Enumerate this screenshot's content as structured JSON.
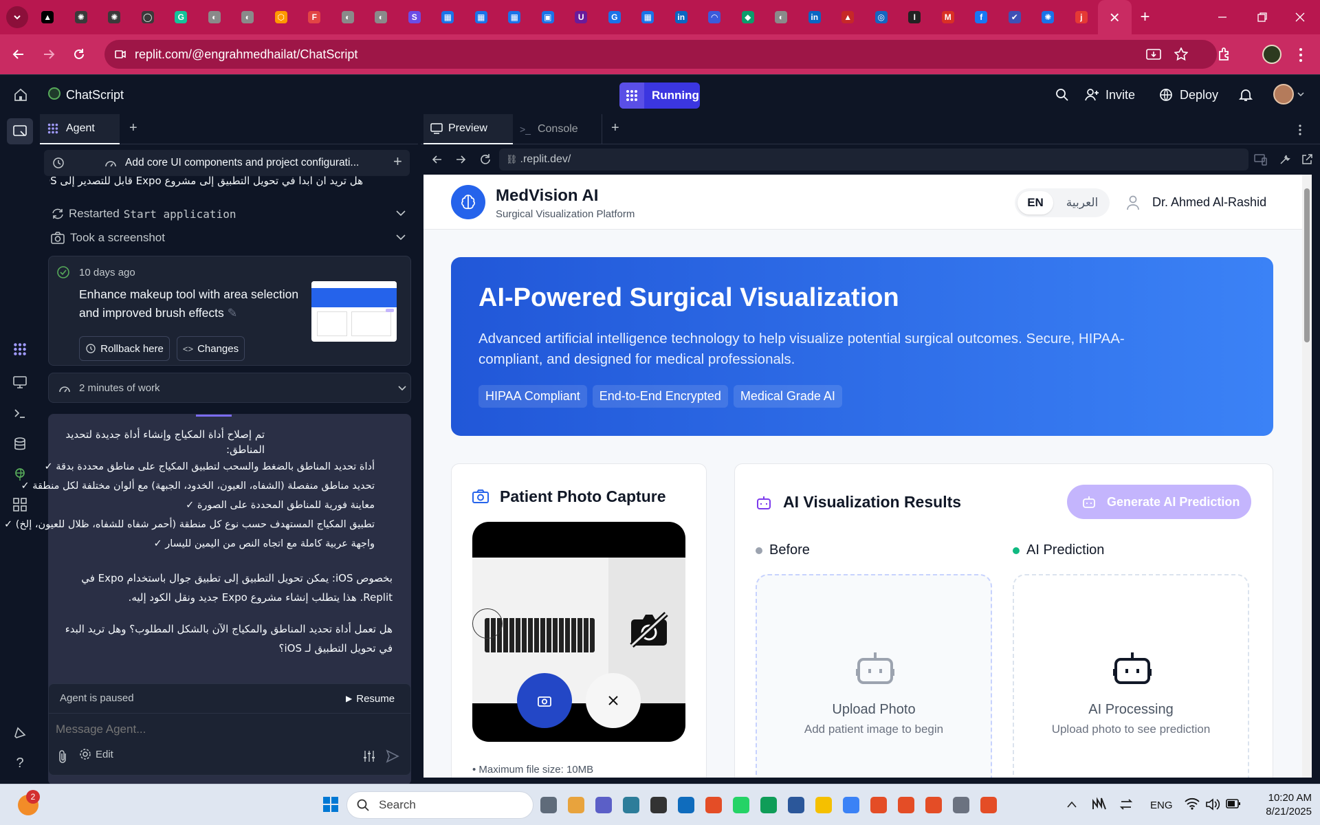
{
  "browser": {
    "tabs": [
      {
        "icon": "chevron-down-icon"
      },
      {
        "icon": "openai-icon",
        "color": "#000000",
        "glyph": "▲"
      },
      {
        "icon": "openai-icon",
        "color": "#3a3a3a",
        "glyph": "✺"
      },
      {
        "icon": "openai-icon",
        "color": "#3a3a3a",
        "glyph": "✺"
      },
      {
        "icon": "github-icon",
        "color": "#3a3a3a",
        "glyph": "◯"
      },
      {
        "icon": "grammarly-icon",
        "color": "#15c39a",
        "glyph": "G"
      },
      {
        "icon": "globe-icon",
        "color": "#8a8a8a",
        "glyph": "◐"
      },
      {
        "icon": "globe-icon",
        "color": "#8a8a8a",
        "glyph": "◐"
      },
      {
        "icon": "hexagon-icon",
        "color": "#ff9800",
        "glyph": "⬡"
      },
      {
        "icon": "figma-icon",
        "color": "#e24545",
        "glyph": "F"
      },
      {
        "icon": "globe-icon",
        "color": "#8a8a8a",
        "glyph": "◐"
      },
      {
        "icon": "globe-icon",
        "color": "#8a8a8a",
        "glyph": "◐"
      },
      {
        "icon": "stripe-icon",
        "color": "#6b4de6",
        "glyph": "S"
      },
      {
        "icon": "grid-icon",
        "color": "#1a73e8",
        "glyph": "▦"
      },
      {
        "icon": "grid-icon",
        "color": "#1a73e8",
        "glyph": "▦"
      },
      {
        "icon": "grid-icon",
        "color": "#1a73e8",
        "glyph": "▦"
      },
      {
        "icon": "teams-icon",
        "color": "#1a73e8",
        "glyph": "▣"
      },
      {
        "icon": "u-icon",
        "color": "#6a1b9a",
        "glyph": "U"
      },
      {
        "icon": "g-icon",
        "color": "#1a73e8",
        "glyph": "G"
      },
      {
        "icon": "grid-icon",
        "color": "#1a73e8",
        "glyph": "▦"
      },
      {
        "icon": "linkedin-icon",
        "color": "#0a66c2",
        "glyph": "in"
      },
      {
        "icon": "edge-icon",
        "color": "#3b5bdb",
        "glyph": "◠"
      },
      {
        "icon": "diamond-icon",
        "color": "#0c9d6c",
        "glyph": "◆"
      },
      {
        "icon": "globe-icon",
        "color": "#8a8a8a",
        "glyph": "◐"
      },
      {
        "icon": "linkedin-icon",
        "color": "#0a66c2",
        "glyph": "in"
      },
      {
        "icon": "app-icon",
        "color": "#c62828",
        "glyph": "▲"
      },
      {
        "icon": "compass-icon",
        "color": "#1565c0",
        "glyph": "◎"
      },
      {
        "icon": "i-icon",
        "color": "#222222",
        "glyph": "I"
      },
      {
        "icon": "gmail-icon",
        "color": "#d93025",
        "glyph": "M"
      },
      {
        "icon": "facebook-icon",
        "color": "#1877f2",
        "glyph": "f"
      },
      {
        "icon": "check-icon",
        "color": "#3f51b5",
        "glyph": "✔"
      },
      {
        "icon": "openai-icon",
        "color": "#1a73e8",
        "glyph": "✺"
      },
      {
        "icon": "j-icon",
        "color": "#e53935",
        "glyph": "j"
      }
    ],
    "active_tab_close": "×",
    "new_tab": "+",
    "url": "replit.com/@engrahmedhailat/ChatScript"
  },
  "replit": {
    "project_name": "ChatScript",
    "running_label": "Running",
    "invite_label": "Invite",
    "deploy_label": "Deploy"
  },
  "agent": {
    "tab_label": "Agent",
    "task_title": "Add core UI components and project configurati...",
    "prev_message_tail": "هل تريد ان ابدا في تحويل التطبيق إلى مشروع Expo قابل للتصدير إلى iOS؟",
    "restarted_label": "Restarted",
    "restarted_code": "Start application",
    "screenshot_label": "Took a screenshot",
    "checkpoint_time": "10 days ago",
    "checkpoint_title": "Enhance makeup tool with area selection and improved brush effects",
    "rollback_label": "Rollback here",
    "changes_label": "Changes",
    "work_label": "2 minutes of work",
    "message": {
      "intro": "تم إصلاح أداة المكياج وإنشاء أداة جديدة لتحديد المناطق:",
      "bullets": [
        "أداة تحديد المناطق بالضغط والسحب لتطبيق المكياج على مناطق محددة بدقة ✓",
        "تحديد مناطق منفصلة (الشفاه، العيون، الخدود، الجبهة) مع ألوان مختلفة لكل منطقة ✓",
        "معاينة فورية للمناطق المحددة على الصورة ✓",
        "تطبيق المكياج المستهدف حسب نوع كل منطقة (أحمر شفاه للشفاه، ظلال للعيون، إلخ) ✓",
        "واجهة عربية كاملة مع اتجاه النص من اليمين لليسار ✓"
      ],
      "ios_note": "بخصوص iOS: يمكن تحويل التطبيق إلى تطبيق جوال باستخدام Expo في Replit. هذا يتطلب إنشاء مشروع Expo جديد ونقل الكود إليه.",
      "question": "هل تعمل أداة تحديد المناطق والمكياج الآن بالشكل المطلوب؟ وهل تريد البدء في تحويل التطبيق لـ iOS؟"
    },
    "paused_label": "Agent is paused",
    "resume_label": "Resume",
    "input_placeholder": "Message Agent...",
    "edit_label": "Edit"
  },
  "preview": {
    "tab_preview": "Preview",
    "tab_console": "Console",
    "url": ".replit.dev/"
  },
  "medvision": {
    "brand_name": "MedVision AI",
    "brand_sub": "Surgical Visualization Platform",
    "lang_en": "EN",
    "lang_ar": "العربية",
    "user_name": "Dr. Ahmed Al-Rashid",
    "hero_title": "AI-Powered Surgical Visualization",
    "hero_desc": "Advanced artificial intelligence technology to help visualize potential surgical outcomes. Secure, HIPAA-compliant, and designed for medical professionals.",
    "badges": [
      "HIPAA Compliant",
      "End-to-End Encrypted",
      "Medical Grade AI"
    ],
    "capture_title": "Patient Photo Capture",
    "max_file": "• Maximum file size: 10MB",
    "results_title": "AI Visualization Results",
    "generate_label": "Generate AI Prediction",
    "before_label": "Before",
    "prediction_label": "AI Prediction",
    "upload_title": "Upload Photo",
    "upload_sub": "Add patient image to begin",
    "processing_title": "AI Processing",
    "processing_sub": "Upload photo to see prediction",
    "colors": {
      "primary": "#2563eb",
      "hero_start": "#2157d8",
      "hero_end": "#3b82f6",
      "generate": "#c4b5fd",
      "ai_green": "#10b981"
    }
  },
  "taskbar": {
    "search_placeholder": "Search",
    "notification_count": "2",
    "language": "ENG",
    "time": "10:20 AM",
    "date": "8/21/2025"
  }
}
